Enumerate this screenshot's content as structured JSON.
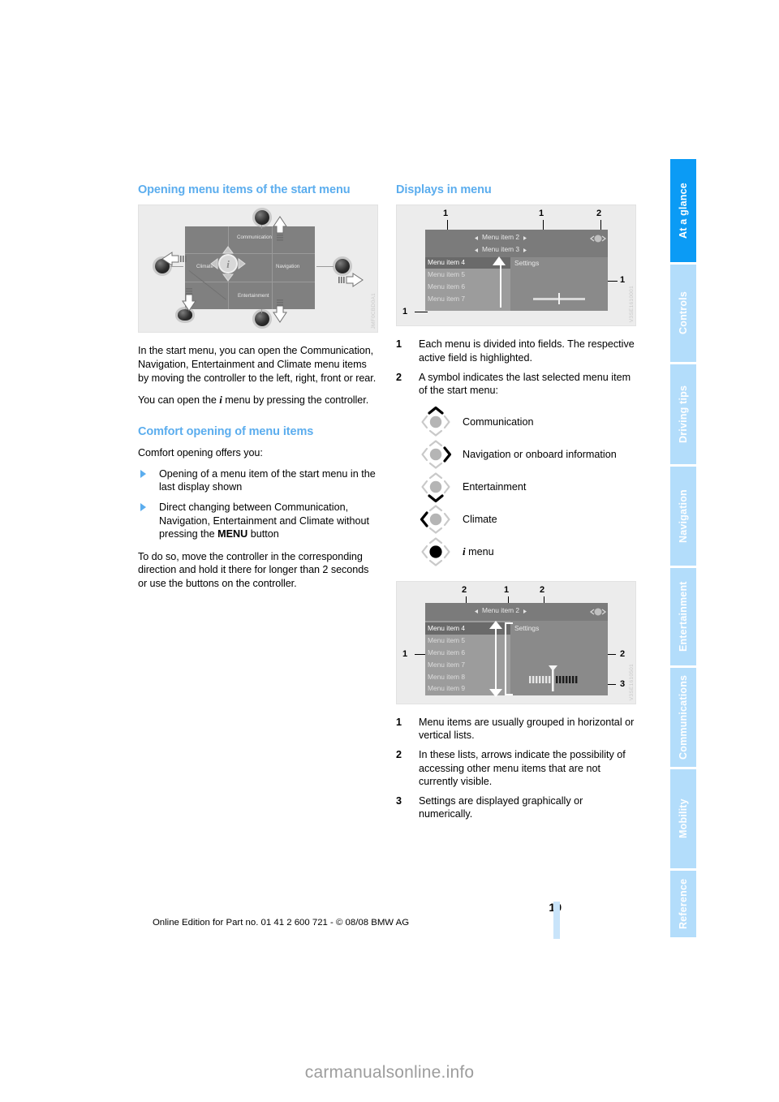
{
  "page": {
    "number": "19",
    "edition_line": "Online Edition for Part no. 01 41 2 600 721 - © 08/08 BMW AG",
    "watermark": "carmanualsonline.info"
  },
  "tabs": [
    {
      "label": "At a glance",
      "active": true
    },
    {
      "label": "Controls",
      "active": false
    },
    {
      "label": "Driving tips",
      "active": false
    },
    {
      "label": "Navigation",
      "active": false
    },
    {
      "label": "Entertainment",
      "active": false
    },
    {
      "label": "Communications",
      "active": false
    },
    {
      "label": "Mobility",
      "active": false
    },
    {
      "label": "Reference",
      "active": false
    }
  ],
  "left_column": {
    "heading_1": "Opening menu items of the start menu",
    "figure_1": {
      "code": "JMF0CBD0A1",
      "labels": [
        "Communication",
        "Climate",
        "Navigation",
        "Entertainment"
      ],
      "center_glyph": "i"
    },
    "para_1": "In the start menu, you can open the Communication, Navigation, Entertainment and Climate menu items by moving the controller to the left, right, front or rear.",
    "para_2_before": "You can open the ",
    "para_2_symbol": "i",
    "para_2_after": " menu by pressing the controller.",
    "heading_2": "Comfort opening of menu items",
    "para_3": "Comfort opening offers you:",
    "bullets": [
      "Opening of a menu item of the start menu in the last display shown",
      "Direct changing between Communication, Navigation, Entertainment and Climate without pressing the MENU button"
    ],
    "bullet_2_parts": {
      "before": "Direct changing between Communication, Navigation, Entertainment and Climate without pressing the ",
      "bold": "MENU",
      "after": " button"
    },
    "para_4": "To do so, move the controller in the corresponding direction and hold it there for longer than 2 seconds or use the buttons on the controller."
  },
  "right_column": {
    "heading_1": "Displays in menu",
    "figure_2": {
      "code": "V3SE1610001",
      "callouts": [
        "1",
        "1",
        "2",
        "1",
        "1"
      ],
      "screen_rows": [
        "Menu item 2",
        "Menu item 3",
        "Menu item 4",
        "Menu item 5",
        "Menu item 6",
        "Menu item 7"
      ],
      "settings_label": "Settings"
    },
    "legend_1": [
      {
        "n": "1",
        "text": "Each menu is divided into fields. The respective active field is highlighted."
      },
      {
        "n": "2",
        "text": "A symbol indicates the last selected menu item of the start menu:"
      }
    ],
    "symbols": [
      {
        "name": "controller-up-symbol",
        "direction": "up",
        "center": "gray",
        "label": "Communication"
      },
      {
        "name": "controller-right-symbol",
        "direction": "right",
        "center": "gray",
        "label": "Navigation or onboard information"
      },
      {
        "name": "controller-down-symbol",
        "direction": "down",
        "center": "gray",
        "label": "Entertainment"
      },
      {
        "name": "controller-left-symbol",
        "direction": "left",
        "center": "gray",
        "label": "Climate"
      },
      {
        "name": "controller-press-symbol",
        "direction": "none",
        "center": "black",
        "label_symbol": "i",
        "label": " menu"
      }
    ],
    "figure_3": {
      "code": "V3SE1610501",
      "callouts": [
        "2",
        "1",
        "2",
        "1",
        "2",
        "3"
      ],
      "screen_rows": [
        "Menu item 2",
        "Menu item 4",
        "Menu item 5",
        "Menu item 6",
        "Menu item 7",
        "Menu item 8",
        "Menu item 9"
      ],
      "settings_label": "Settings"
    },
    "legend_2": [
      {
        "n": "1",
        "text": "Menu items are usually grouped in horizontal or vertical lists."
      },
      {
        "n": "2",
        "text": "In these lists, arrows indicate the possibility of accessing other menu items that are not currently visible."
      },
      {
        "n": "3",
        "text": "Settings are displayed graphically or numerically."
      }
    ]
  },
  "colors": {
    "heading_blue": "#5BADEE",
    "tab_active": "#0B9BF5",
    "tab_inactive": "#B3DDFB",
    "footer_bar": "#C9E4FA"
  }
}
